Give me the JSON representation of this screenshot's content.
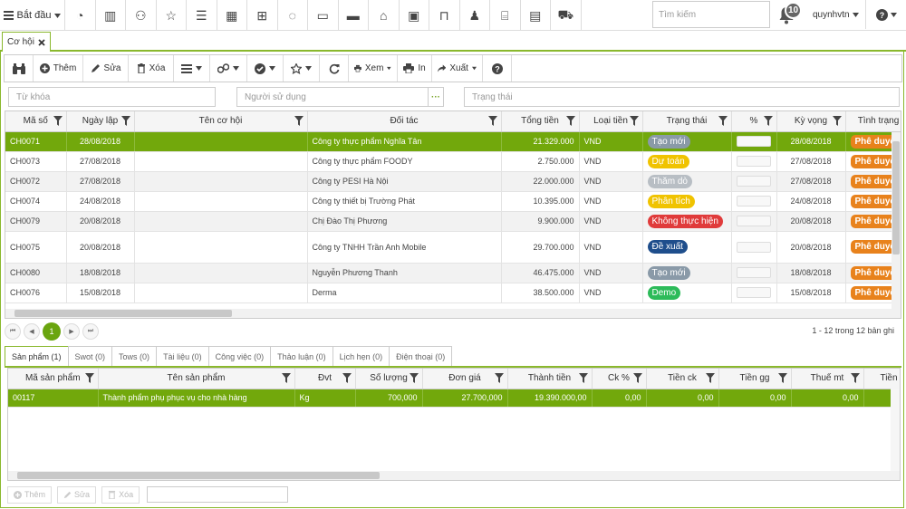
{
  "topbar": {
    "start_label": "Bắt đầu",
    "search_placeholder": "Tìm kiếm",
    "notification_count": "10",
    "username": "quynhvtn",
    "icons": [
      "dashboard-icon",
      "bar-chart-icon",
      "user-icon",
      "star-icon",
      "list-icon",
      "calendar-icon",
      "calendar-plus-icon",
      "spinner-icon",
      "card-icon",
      "credit-card-icon",
      "bank-icon",
      "money-icon",
      "bookmark-icon",
      "person-icon",
      "shop-icon",
      "briefcase-icon",
      "cart-icon"
    ]
  },
  "tabs": {
    "main_tab": "Cơ hội"
  },
  "toolbar": {
    "add": "Thêm",
    "edit": "Sửa",
    "delete": "Xóa",
    "view": "Xem",
    "print": "In",
    "export": "Xuất"
  },
  "filters": {
    "keyword": "Từ khóa",
    "user": "Người sử dụng",
    "status": "Trạng thái",
    "dots": "···"
  },
  "grid": {
    "headers": [
      "Mã số",
      "Ngày lập",
      "Tên cơ hội",
      "Đối tác",
      "Tổng tiền",
      "Loại tiền",
      "Trạng thái",
      "%",
      "Kỳ vọng",
      "Tình trạng"
    ],
    "rows": [
      {
        "code": "CH0071",
        "date": "28/08/2018",
        "name": "",
        "partner": "Công ty thực phẩm Nghĩa Tân",
        "total": "21.329.000",
        "currency": "VND",
        "status": "Tạo mới",
        "status_color": "#8a9aa8",
        "expected": "28/08/2018",
        "state": "Phê duyệt"
      },
      {
        "code": "CH0073",
        "date": "27/08/2018",
        "name": "",
        "partner": "Công ty thực phẩm FOODY",
        "total": "2.750.000",
        "currency": "VND",
        "status": "Dự toán",
        "status_color": "#f0c300",
        "expected": "27/08/2018",
        "state": "Phê duyệt"
      },
      {
        "code": "CH0072",
        "date": "27/08/2018",
        "name": "",
        "partner": "Công ty PESI Hà Nội",
        "total": "22.000.000",
        "currency": "VND",
        "status": "Thăm dò",
        "status_color": "#b8bec4",
        "expected": "27/08/2018",
        "state": "Phê duyệt"
      },
      {
        "code": "CH0074",
        "date": "24/08/2018",
        "name": "",
        "partner": "Công ty thiết bị Trường Phát",
        "total": "10.395.000",
        "currency": "VND",
        "status": "Phân tích",
        "status_color": "#f0c300",
        "expected": "24/08/2018",
        "state": "Phê duyệt"
      },
      {
        "code": "CH0079",
        "date": "20/08/2018",
        "name": "",
        "partner": "Chị Đào Thị Phương",
        "total": "9.900.000",
        "currency": "VND",
        "status": "Không thực hiện",
        "status_color": "#e03b3b",
        "expected": "20/08/2018",
        "state": "Phê duyệt"
      },
      {
        "code": "CH0075",
        "date": "20/08/2018",
        "name": "",
        "partner": "Công ty TNHH Trần Anh Mobile",
        "total": "29.700.000",
        "currency": "VND",
        "status": "Đề xuất",
        "status_color": "#1f4e8c",
        "expected": "20/08/2018",
        "state": "Phê duyệt"
      },
      {
        "code": "CH0080",
        "date": "18/08/2018",
        "name": "",
        "partner": "Nguyễn Phương Thanh",
        "total": "46.475.000",
        "currency": "VND",
        "status": "Tạo mới",
        "status_color": "#8a9aa8",
        "expected": "18/08/2018",
        "state": "Phê duyệt"
      },
      {
        "code": "CH0076",
        "date": "15/08/2018",
        "name": "",
        "partner": "Derma",
        "total": "38.500.000",
        "currency": "VND",
        "status": "Demo",
        "status_color": "#2dbb5a",
        "expected": "15/08/2018",
        "state": "Phê duyệt"
      }
    ]
  },
  "pager": {
    "current": "1",
    "info": "1 - 12 trong 12 bản ghi"
  },
  "subtabs": [
    "Sản phẩm (1)",
    "Swot (0)",
    "Tows (0)",
    "Tài liệu (0)",
    "Công việc (0)",
    "Thảo luận (0)",
    "Lịch hẹn (0)",
    "Điện thoại (0)"
  ],
  "products": {
    "headers": [
      "Mã sản phẩm",
      "Tên sản phẩm",
      "Đvt",
      "Số lượng",
      "Đơn giá",
      "Thành tiền",
      "Ck %",
      "Tiền ck",
      "Tiền gg",
      "Thuế mt",
      "Tiền"
    ],
    "rows": [
      {
        "code": "00117",
        "name": "Thành phẩm phụ phục vụ cho nhà hàng",
        "unit": "Kg",
        "qty": "700,000",
        "price": "27.700,000",
        "amount": "19.390.000,00",
        "ck": "0,00",
        "ck_amt": "0,00",
        "gg": "0,00",
        "tax": "0,00",
        "other": ""
      }
    ]
  },
  "bottom": {
    "add": "Thêm",
    "edit": "Sửa",
    "delete": "Xóa"
  },
  "colors": {
    "accent": "#8ab82d",
    "selected_row": "#72a80c",
    "approve": "#e8821c"
  }
}
